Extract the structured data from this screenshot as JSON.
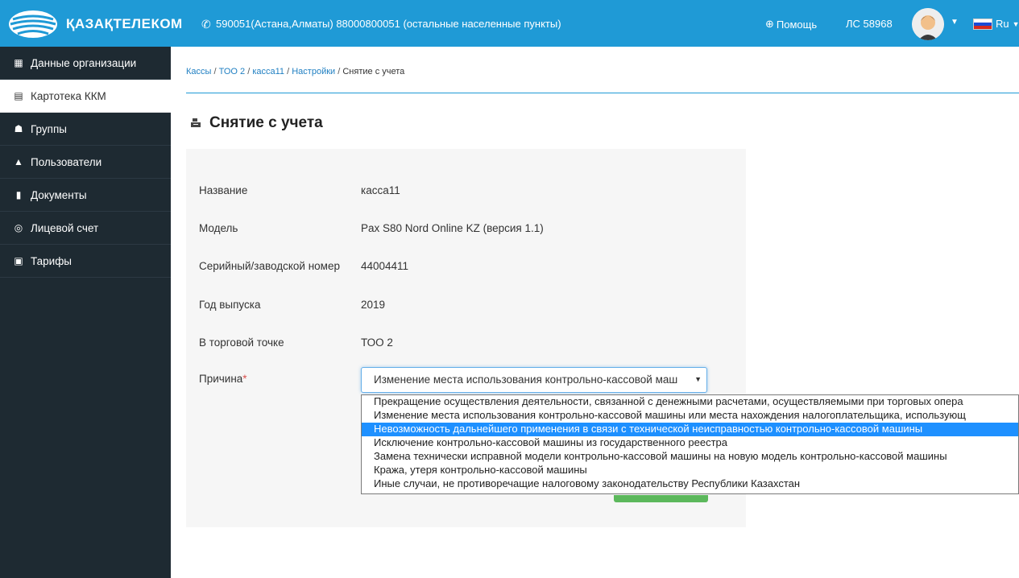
{
  "header": {
    "brand": "ҚАЗАҚТЕЛЕКОМ",
    "phone": "590051(Астана,Алматы) 88000800051 (остальные населенные пункты)",
    "help_label": "Помощь",
    "account": "ЛС 58968",
    "language": "Ru",
    "colors": {
      "bar": "#1f9ad6"
    }
  },
  "sidebar": {
    "items": [
      {
        "label": "Данные организации",
        "icon": "building-icon"
      },
      {
        "label": "Картотека ККМ",
        "icon": "calculator-icon",
        "active": true
      },
      {
        "label": "Группы",
        "icon": "group-icon"
      },
      {
        "label": "Пользователи",
        "icon": "user-icon"
      },
      {
        "label": "Документы",
        "icon": "document-icon"
      },
      {
        "label": "Лицевой счет",
        "icon": "coins-icon"
      },
      {
        "label": "Тарифы",
        "icon": "tariff-icon"
      }
    ]
  },
  "breadcrumb": {
    "items": [
      "Кассы",
      "ТОО 2",
      "касса11",
      "Настройки"
    ],
    "current": "Снятие с учета",
    "separator": "/"
  },
  "page": {
    "title": "Снятие с учета"
  },
  "form": {
    "fields": [
      {
        "label": "Название",
        "value": "касса11"
      },
      {
        "label": "Модель",
        "value": "Pax S80 Nord Online KZ (версия 1.1)"
      },
      {
        "label": "Серийный/заводской номер",
        "value": "44004411"
      },
      {
        "label": "Год выпуска",
        "value": "2019"
      },
      {
        "label": "В торговой точке",
        "value": "ТОО 2"
      }
    ],
    "reason": {
      "label": "Причина",
      "required_mark": "*",
      "selected": "Изменение места использования контрольно-кассовой маш",
      "options": [
        "Прекращение осуществления деятельности, связанной с денежными расчетами, осуществляемыми при торговых опера",
        "Изменение места использования контрольно-кассовой машины или места нахождения налогоплательщика, использующ",
        "Невозможность дальнейшего применения в связи с технической неисправностью контрольно-кассовой машины",
        "Исключение контрольно-кассовой машины из государственного реестра",
        "Замена технически исправной модели контрольно-кассовой машины на новую модель контрольно-кассовой машины",
        "Кража, утеря контрольно-кассовой машины",
        "Иные случаи, не противоречащие налоговому законодательству Республики Казахстан"
      ],
      "highlighted_index": 2
    }
  }
}
